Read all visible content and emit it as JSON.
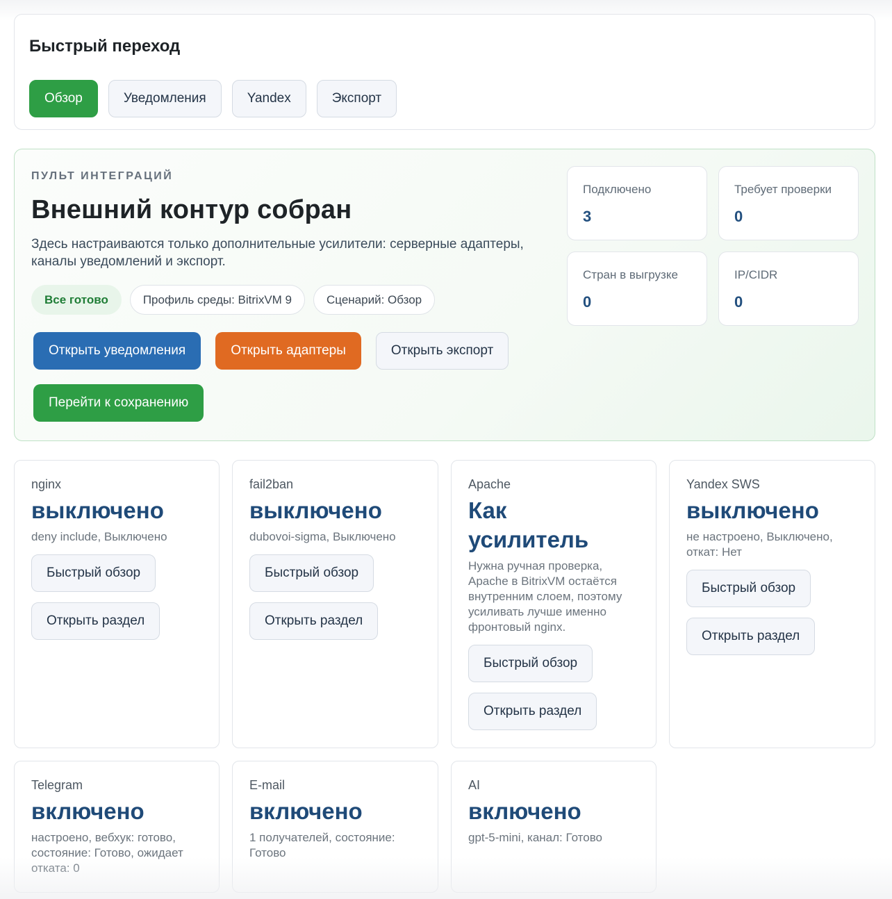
{
  "quick_nav": {
    "title": "Быстрый переход",
    "items": [
      {
        "label": "Обзор",
        "active": true
      },
      {
        "label": "Уведомления",
        "active": false
      },
      {
        "label": "Yandex",
        "active": false
      },
      {
        "label": "Экспорт",
        "active": false
      }
    ]
  },
  "hero": {
    "eyebrow": "ПУЛЬТ ИНТЕГРАЦИЙ",
    "title": "Внешний контур собран",
    "description": "Здесь настраиваются только дополнительные усилители: серверные адаптеры, каналы уведомлений и экспорт.",
    "pills": {
      "status": "Все готово",
      "profile": "Профиль среды: BitrixVM 9",
      "scenario": "Сценарий: Обзор"
    },
    "actions": {
      "open_notifications": "Открыть уведомления",
      "open_adapters": "Открыть адаптеры",
      "open_export": "Открыть экспорт",
      "go_save": "Перейти к сохранению"
    },
    "stats": [
      {
        "label": "Подключено",
        "value": "3"
      },
      {
        "label": "Требует проверки",
        "value": "0"
      },
      {
        "label": "Стран в выгрузке",
        "value": "0"
      },
      {
        "label": "IP/CIDR",
        "value": "0"
      }
    ]
  },
  "cards": [
    {
      "name": "nginx",
      "state": "выключено",
      "detail": "deny include, Выключено",
      "quick": "Быстрый обзор",
      "open": "Открыть раздел"
    },
    {
      "name": "fail2ban",
      "state": "выключено",
      "detail": "dubovoi-sigma, Выключено",
      "quick": "Быстрый обзор",
      "open": "Открыть раздел"
    },
    {
      "name": "Apache",
      "state": "Как усилитель",
      "detail": "Нужна ручная проверка, Apache в BitrixVM остаётся внутренним слоем, поэтому усиливать лучше именно фронтовый nginx.",
      "quick": "Быстрый обзор",
      "open": "Открыть раздел"
    },
    {
      "name": "Yandex SWS",
      "state": "выключено",
      "detail": "не настроено, Выключено, откат: Нет",
      "quick": "Быстрый обзор",
      "open": "Открыть раздел"
    },
    {
      "name": "Telegram",
      "state": "включено",
      "detail": "настроено, вебхук: готово, состояние: Готово, ожидает отката: 0"
    },
    {
      "name": "E-mail",
      "state": "включено",
      "detail": "1 получателей, состояние: Готово"
    },
    {
      "name": "AI",
      "state": "включено",
      "detail": "gpt-5-mini, канал: Готово"
    }
  ]
}
